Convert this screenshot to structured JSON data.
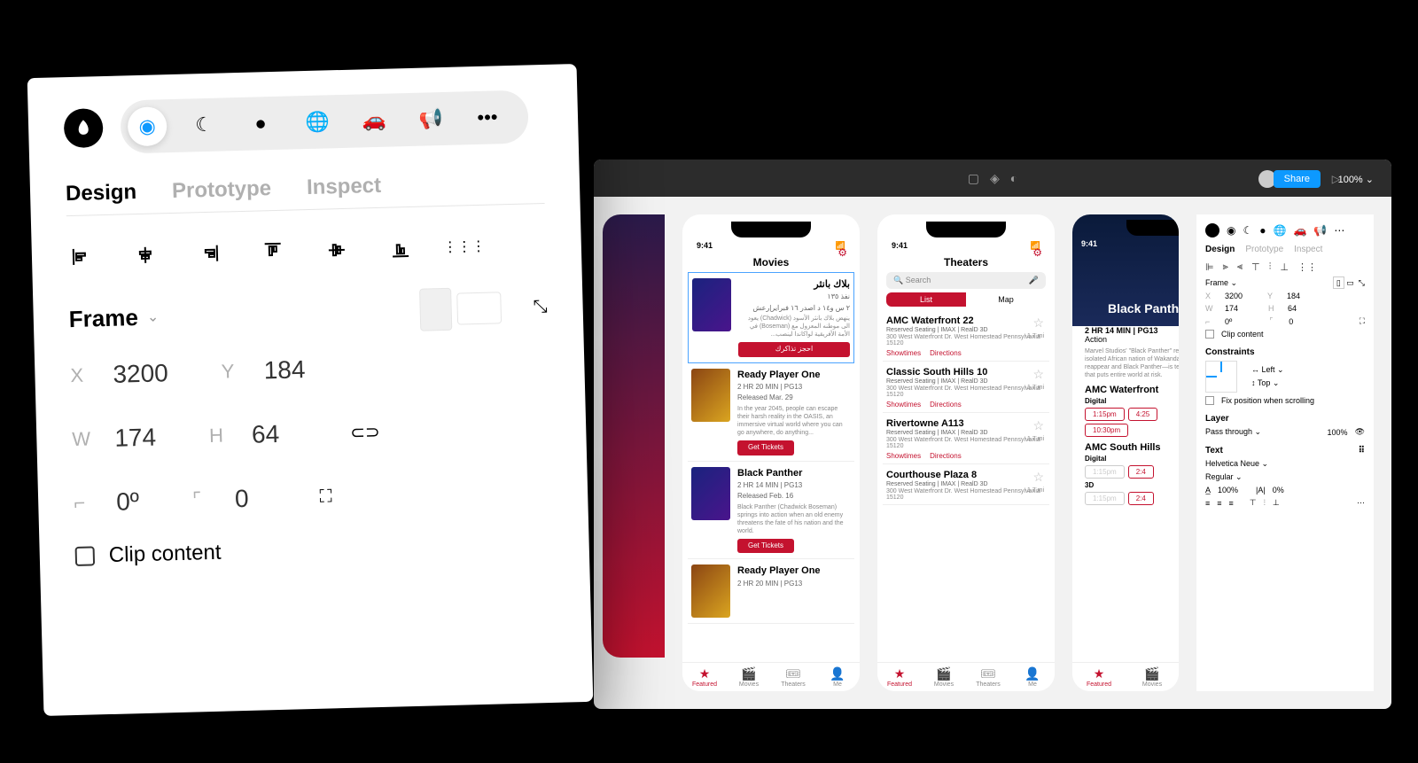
{
  "left_panel": {
    "tabs": {
      "design": "Design",
      "prototype": "Prototype",
      "inspect": "Inspect"
    },
    "frame": {
      "title": "Frame",
      "x_label": "X",
      "x": "3200",
      "y_label": "Y",
      "y": "184",
      "w_label": "W",
      "w": "174",
      "h_label": "H",
      "h": "64",
      "r_label": "⌐",
      "r": "0º",
      "c_label": "⌜",
      "c": "0",
      "clip": "Clip content"
    }
  },
  "top": {
    "share": "Share",
    "zoom": "100% ⌄"
  },
  "side_panel": {
    "tabs": {
      "design": "Design",
      "prototype": "Prototype",
      "inspect": "Inspect"
    },
    "frame": "Frame ⌄",
    "x_label": "X",
    "x": "3200",
    "y_label": "Y",
    "y": "184",
    "w_label": "W",
    "w": "174",
    "h_label": "H",
    "h": "64",
    "r": "0º",
    "c": "0",
    "clip": "Clip content",
    "constraints": "Constraints",
    "left": "↔ Left ⌄",
    "top_c": "↕ Top ⌄",
    "fix": "Fix position when scrolling",
    "layer": "Layer",
    "pass": "Pass through ⌄",
    "opacity": "100%",
    "text": "Text",
    "font": "Helvetica Neue ⌄",
    "weight": "Regular ⌄",
    "lh": "100%",
    "ls": "0%"
  },
  "phones": {
    "time": "9:41",
    "movies": {
      "title": "Movies",
      "arabic_title": "بلاك بانثر",
      "arabic_meta": "نفذ ١٣٥",
      "arabic_line": "٢ س و١٤ د اصدر ١٦ فبراير|رعش",
      "arabic_desc": "ينهض بلاك بانثر الأسود (Chadwick) يعود الى موطنه المعزول مع (Boseman) في الأمة الأفريقية لواكاندا لينصب...",
      "book": "احجز تذاكرك",
      "m1": {
        "name": "Ready Player One",
        "meta": "2 HR 20 MIN | PG13",
        "rel": "Released Mar. 29",
        "desc": "In the year 2045, people can escape their harsh reality in the OASIS, an immersive virtual world where you can go anywhere, do anything...",
        "btn": "Get Tickets"
      },
      "m2": {
        "name": "Black Panther",
        "meta": "2 HR 14 MIN | PG13",
        "rel": "Released Feb. 16",
        "desc": "Black Panther (Chadwick Boseman) springs into action when an old enemy threatens the fate of his nation and the world.",
        "btn": "Get Tickets"
      },
      "m3": {
        "name": "Ready Player One",
        "meta": "2 HR 20 MIN | PG13"
      }
    },
    "theaters": {
      "title": "Theaters",
      "search": "Search",
      "list": "List",
      "map": "Map",
      "t1": {
        "name": "AMC Waterfront 22",
        "meta": "Reserved Seating | IMAX | RealD 3D",
        "addr": "300 West Waterfront Dr. West Homestead Pennsylvania 15120",
        "dist": "1.7 mi"
      },
      "t2": {
        "name": "Classic South Hills 10",
        "meta": "Reserved Seating | IMAX | RealD 3D",
        "addr": "300 West Waterfront Dr. West Homestead Pennsylvania 15120",
        "dist": "1.7 mi"
      },
      "t3": {
        "name": "Rivertowne A113",
        "meta": "Reserved Seating | IMAX | RealD 3D",
        "addr": "300 West Waterfront Dr. West Homestead Pennsylvania 15120",
        "dist": "1.7 mi"
      },
      "t4": {
        "name": "Courthouse Plaza 8",
        "meta": "Reserved Seating | IMAX | RealD 3D",
        "addr": "300 West Waterfront Dr. West Homestead Pennsylvania 15120",
        "dist": "1.7 mi"
      },
      "showtimes": "Showtimes",
      "directions": "Directions"
    },
    "detail": {
      "title": "Black Panther",
      "meta": "2 HR 14 MIN | PG13",
      "genre": "Action",
      "desc": "Marvel Studios' \"Black Panther\" returns home to the isolated African nation of Wakanda to powerful old enemy reappear and Black Panther—is tested formidable conflict that puts entire world at risk.",
      "th1": "AMC Waterfront",
      "th2": "AMC South Hills",
      "digital": "Digital",
      "threed": "3D",
      "times": {
        "a": "1:15pm",
        "b": "4:25",
        "c": "10:30pm",
        "d": "1:15pm",
        "e": "2:4",
        "f": "1:15pm",
        "g": "2:4"
      }
    },
    "tabs": {
      "featured": "Featured",
      "movies": "Movies",
      "theaters": "Theaters",
      "me": "Me"
    }
  }
}
